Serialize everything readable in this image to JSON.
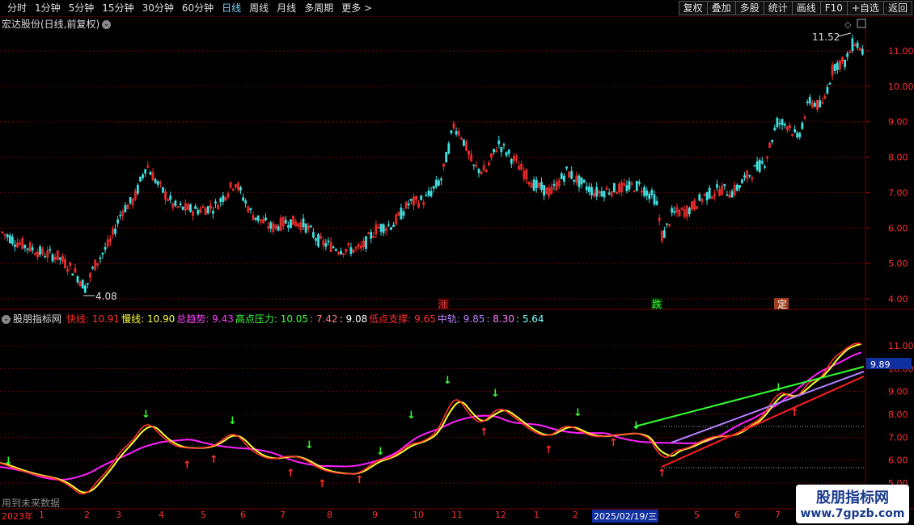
{
  "toolbar": {
    "periods": [
      "分时",
      "1分钟",
      "5分钟",
      "15分钟",
      "30分钟",
      "60分钟",
      "日线",
      "周线",
      "月线",
      "多周期",
      "更多 >"
    ],
    "active_period": "日线",
    "buttons": [
      "复权",
      "叠加",
      "多股",
      "统计",
      "画线",
      "F10",
      "+自选",
      "返回"
    ]
  },
  "main_chart": {
    "title": "宏达股份(日线,前复权)",
    "high_label": "11.52",
    "low_label": "4.08",
    "y_ticks": [
      "11.00",
      "10.00",
      "9.00",
      "8.00",
      "7.00",
      "6.00",
      "5.00",
      "4.00"
    ],
    "markers": [
      "涨",
      "跌",
      "定"
    ]
  },
  "indicator": {
    "name": "股朋指标网",
    "items": [
      {
        "label": "快线:",
        "value": "10.91",
        "color": "#ff3030"
      },
      {
        "label": "慢线:",
        "value": "10.90",
        "color": "#ffff40"
      },
      {
        "label": "总趋势:",
        "value": "9.43",
        "color": "#ff40ff"
      },
      {
        "label": "高点压力:",
        "value": "10.05",
        "color": "#40ff40"
      },
      {
        "label": ":",
        "value": "7.42",
        "color": "#ff8080"
      },
      {
        "label": ":",
        "value": "9.08",
        "color": "#ffffff"
      },
      {
        "label": "低点支撑:",
        "value": "9.65",
        "color": "#ff3030"
      },
      {
        "label": "中轨:",
        "value": "9.85",
        "color": "#c080ff"
      },
      {
        "label": ":",
        "value": "8.30",
        "color": "#ff80ff"
      },
      {
        "label": ":",
        "value": "5.64",
        "color": "#80ffff"
      }
    ],
    "y_ticks": [
      "11.00",
      "10.00",
      "9.00",
      "8.00",
      "7.00",
      "6.00",
      "5.00"
    ],
    "current_value": "9.89"
  },
  "bottom_note": "用到未来数据",
  "date_axis": {
    "year_label": "2023年",
    "months": [
      "1",
      "2",
      "3",
      "4",
      "5",
      "6",
      "7",
      "8",
      "9",
      "10",
      "11",
      "12",
      "1",
      "2",
      "5",
      "6",
      "7"
    ],
    "selected_date": "2025/02/19/三"
  },
  "watermark": {
    "line1": "股朋指标网",
    "line2": "www.7gpzb.com"
  }
}
